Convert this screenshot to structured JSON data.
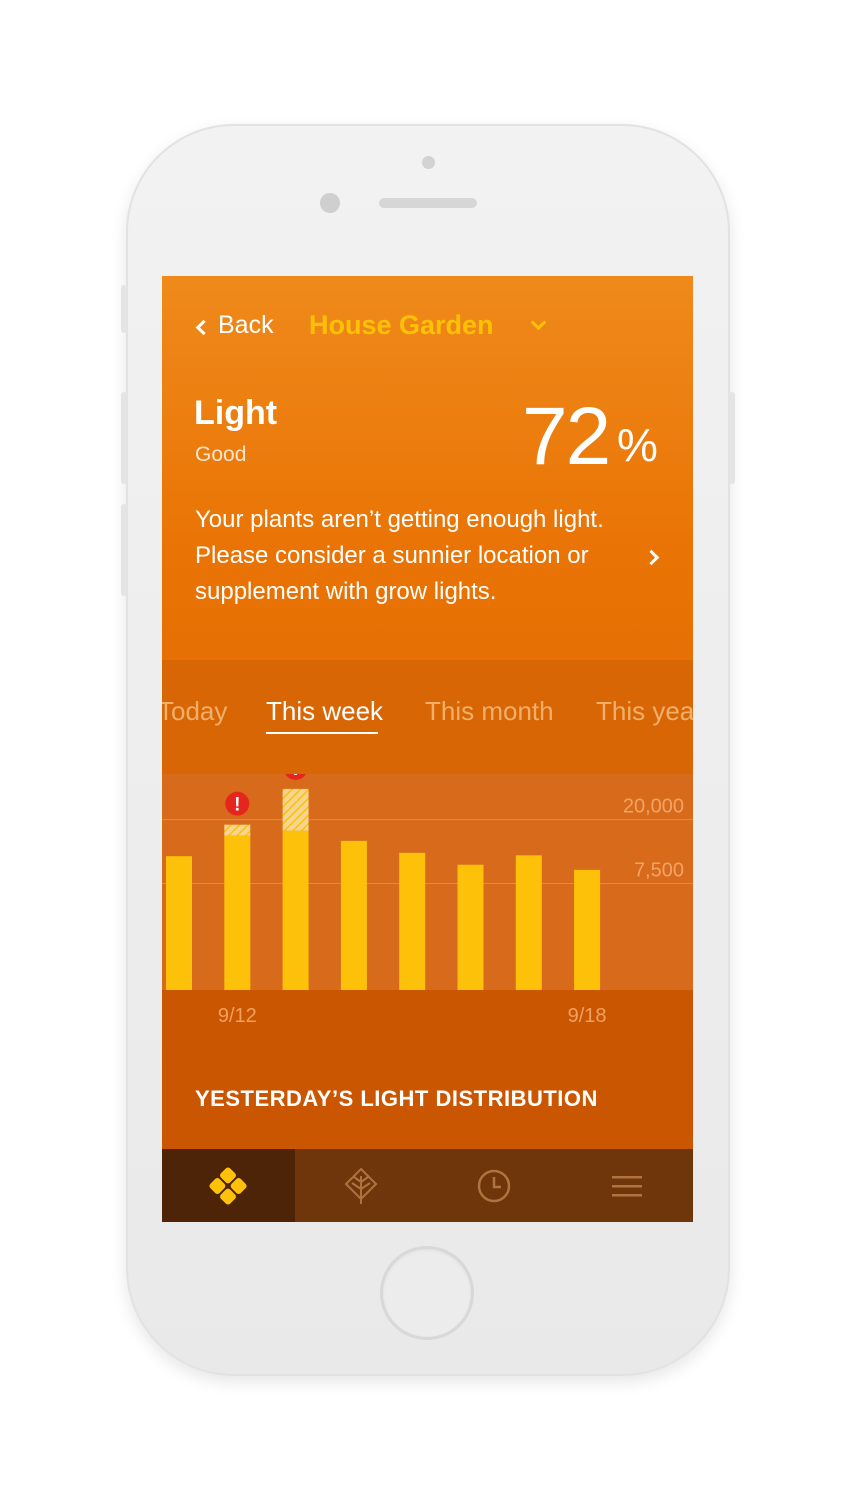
{
  "nav": {
    "back_label": "Back",
    "title": "House Garden"
  },
  "metric": {
    "name": "Light",
    "status": "Good",
    "value": "72",
    "unit": "%"
  },
  "message": {
    "lines": [
      "Your plants aren’t getting enough light.",
      "Please consider a sunnier location or",
      "supplement with grow lights."
    ]
  },
  "tabs": [
    {
      "label": "Today",
      "active": false
    },
    {
      "label": "This week",
      "active": true
    },
    {
      "label": "This month",
      "active": false
    },
    {
      "label": "This year",
      "active": false
    }
  ],
  "chart_data": {
    "type": "bar",
    "y_ticks": [
      "20,000",
      "7,500"
    ],
    "x_tick_labels": [
      "9/12",
      "9/18"
    ],
    "values": [
      15700,
      18100,
      18700,
      17500,
      16100,
      14700,
      15800,
      14100
    ],
    "overflow": [
      0,
      1300,
      4900,
      0,
      0,
      0,
      0,
      0
    ],
    "alerts": [
      false,
      true,
      true,
      false,
      false,
      false,
      false,
      false
    ],
    "alert_symbol": "!",
    "bar_color": "#fec10a",
    "alert_color": "#e5261c"
  },
  "section": {
    "title": "YESTERDAY’S LIGHT DISTRIBUTION"
  },
  "tabbar": {
    "items": [
      {
        "icon": "sensor-diamond-icon",
        "selected": true
      },
      {
        "icon": "leaf-icon",
        "selected": false
      },
      {
        "icon": "clock-icon",
        "selected": false
      },
      {
        "icon": "menu-icon",
        "selected": false
      }
    ]
  },
  "colors": {
    "accent": "#ffc107",
    "header_gradient_top": "#ef8a1b",
    "tabbar_bg": "#6f360c"
  }
}
